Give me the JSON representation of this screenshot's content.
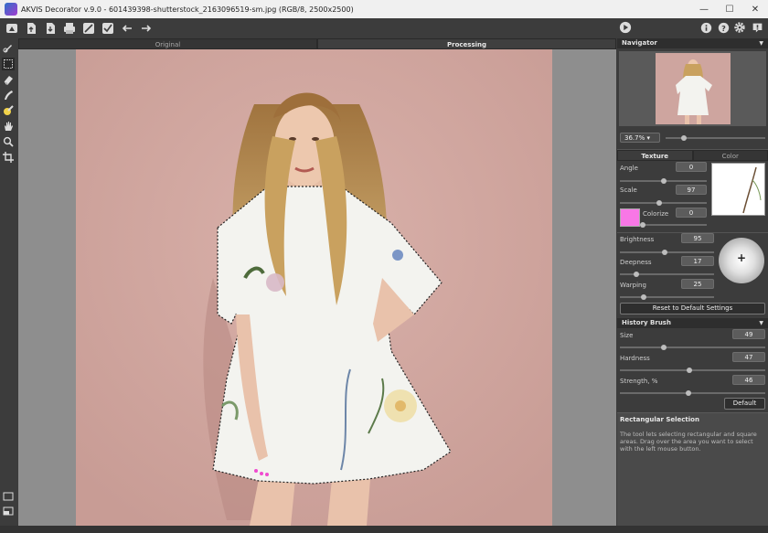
{
  "window": {
    "title": "AKVIS Decorator v.9.0 - 601439398-shutterstock_2163096519-sm.jpg (RGB/8, 2500x2500)",
    "minimize": "—",
    "maximize": "☐",
    "close": "✕"
  },
  "toolbar": {
    "left_icons": [
      "home-icon",
      "open-file-icon",
      "save-file-icon",
      "print-icon",
      "apply-preset-icon",
      "settings-check-icon",
      "undo-arrow-icon",
      "redo-arrow-icon"
    ],
    "right_icons": [
      "run-icon",
      "info-icon",
      "help-icon",
      "gear-icon",
      "notification-icon"
    ]
  },
  "tools": [
    "selection-brush-icon",
    "rectangular-selection-icon",
    "eraser-icon",
    "magic-tube-icon",
    "history-brush-icon",
    "hand-icon",
    "zoom-icon",
    "crop-icon"
  ],
  "tabs": {
    "original": "Original",
    "processing": "Processing"
  },
  "navigator": {
    "title": "Navigator",
    "zoom": "36.7%",
    "zoom_level": 0.18
  },
  "texture_tabs": {
    "texture": "Texture",
    "color": "Color"
  },
  "texture": {
    "angle": {
      "label": "Angle",
      "value": "0",
      "level": 0.5
    },
    "scale": {
      "label": "Scale",
      "value": "97",
      "level": 0.45
    },
    "colorize": {
      "label": "Colorize",
      "value": "0",
      "level": 0.0,
      "swatch": "#f877e6"
    }
  },
  "adjust": {
    "brightness": {
      "label": "Brightness",
      "value": "95",
      "level": 0.48
    },
    "deepness": {
      "label": "Deepness",
      "value": "17",
      "level": 0.17
    },
    "warping": {
      "label": "Warping",
      "value": "25",
      "level": 0.25
    }
  },
  "reset_button": "Reset to Default Settings",
  "history_brush": {
    "title": "History Brush",
    "size": {
      "label": "Size",
      "value": "49",
      "level": 0.3
    },
    "hardness": {
      "label": "Hardness",
      "value": "47",
      "level": 0.48
    },
    "strength": {
      "label": "Strength, %",
      "value": "46",
      "level": 0.47
    },
    "default_button": "Default"
  },
  "hint": {
    "title": "Rectangular Selection",
    "text": "The tool lets selecting rectangular and square areas. Drag over the area you want to select with the left mouse button."
  },
  "colors": {
    "accent_pink": "#f877e6",
    "photo_bg": "#cea59f"
  }
}
